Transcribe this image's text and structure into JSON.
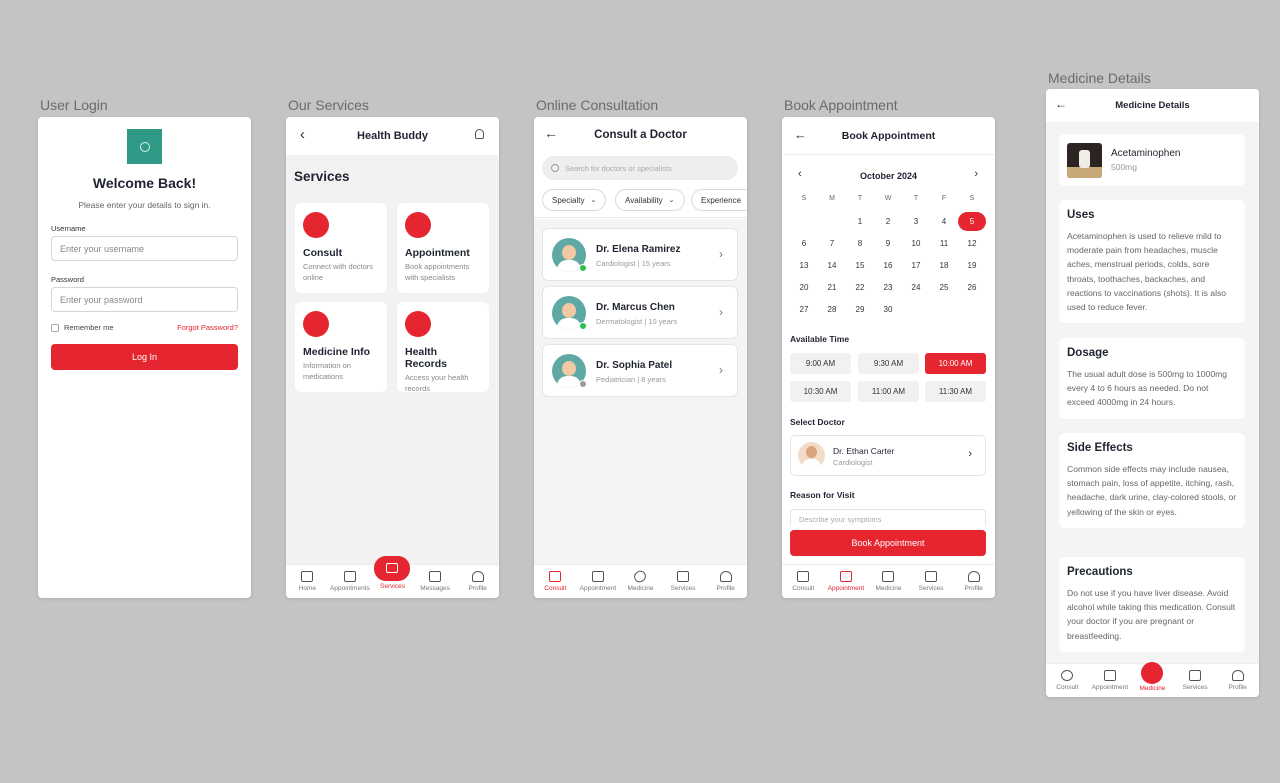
{
  "labels": {
    "login": "User Login",
    "services": "Our Services",
    "consult": "Online Consultation",
    "book": "Book Appointment",
    "medicine": "Medicine Details"
  },
  "login": {
    "title": "Welcome Back!",
    "subtitle": "Please enter your details to sign in.",
    "username_label": "Username",
    "username_placeholder": "Enter your username",
    "password_label": "Password",
    "password_placeholder": "Enter your password",
    "remember": "Remember me",
    "forgot": "Forgot Password?",
    "login_button": "Log In"
  },
  "services": {
    "app_title": "Health Buddy",
    "heading": "Services",
    "cards": [
      {
        "title": "Consult",
        "desc": "Connect with doctors online"
      },
      {
        "title": "Appointment",
        "desc": "Book appointments with specialists"
      },
      {
        "title": "Medicine Info",
        "desc": "Information on medications"
      },
      {
        "title": "Health Records",
        "desc": "Access your health records"
      }
    ],
    "nav": [
      "Home",
      "Appointments",
      "Services",
      "Messages",
      "Profile"
    ]
  },
  "consult": {
    "title": "Consult a Doctor",
    "search_placeholder": "Search for doctors or specialists",
    "filters": [
      "Specialty",
      "Availability",
      "Experience"
    ],
    "doctors": [
      {
        "name": "Dr. Elena Ramirez",
        "spec": "Cardiologist | 15 years",
        "status_color": "#27c24c"
      },
      {
        "name": "Dr. Marcus Chen",
        "spec": "Dermatologist | 10 years",
        "status_color": "#27c24c"
      },
      {
        "name": "Dr. Sophia Patel",
        "spec": "Pediatrician | 8 years",
        "status_color": "#9a9a9a"
      }
    ],
    "nav": [
      "Consult",
      "Appointment",
      "Medicine",
      "Services",
      "Profile"
    ]
  },
  "book": {
    "title": "Book Appointment",
    "month": "October 2024",
    "weekdays": [
      "S",
      "M",
      "T",
      "W",
      "T",
      "F",
      "S"
    ],
    "days": [
      "",
      "",
      "1",
      "2",
      "3",
      "4",
      "5",
      "6",
      "7",
      "8",
      "9",
      "10",
      "11",
      "12",
      "13",
      "14",
      "15",
      "16",
      "17",
      "18",
      "19",
      "20",
      "21",
      "22",
      "23",
      "24",
      "25",
      "26",
      "27",
      "28",
      "29",
      "30"
    ],
    "available_time_label": "Available Time",
    "times": [
      "9:00 AM",
      "9:30 AM",
      "10:00 AM",
      "10:30 AM",
      "11:00 AM",
      "11:30 AM"
    ],
    "select_doctor_label": "Select Doctor",
    "doctor_name": "Dr. Ethan Carter",
    "doctor_spec": "Cardiologist",
    "reason_label": "Reason for Visit",
    "reason_placeholder": "Describe your symptoms",
    "book_button": "Book Appointment",
    "nav": [
      "Consult",
      "Appointment",
      "Medicine",
      "Services",
      "Profile"
    ]
  },
  "medicine": {
    "title": "Medicine Details",
    "name": "Acetaminophen",
    "dose": "500mg",
    "sections": [
      {
        "heading": "Uses",
        "text": "Acetaminophen is used to relieve mild to moderate pain from headaches, muscle aches, menstrual periods, colds, sore throats, toothaches, backaches, and reactions to vaccinations (shots). It is also used to reduce fever."
      },
      {
        "heading": "Dosage",
        "text": "The usual adult dose is 500mg to 1000mg every 4 to 6 hours as needed. Do not exceed 4000mg in 24 hours."
      },
      {
        "heading": "Side Effects",
        "text": "Common side effects may include nausea, stomach pain, loss of appetite, itching, rash, headache, dark urine, clay-colored stools, or yellowing of the skin or eyes."
      },
      {
        "heading": "Precautions",
        "text": "Do not use if you have liver disease. Avoid alcohol while taking this medication. Consult your doctor if you are pregnant or breastfeeding."
      }
    ],
    "nav": [
      "Consult",
      "Appointment",
      "Medicine",
      "Services",
      "Profile"
    ]
  },
  "colors": {
    "accent": "#e5252f",
    "logo": "#2f9a86"
  }
}
